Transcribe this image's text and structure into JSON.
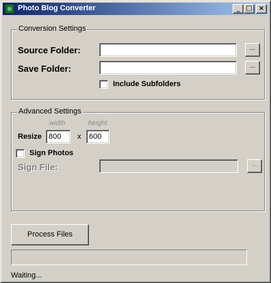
{
  "window": {
    "title": "Photo Blog Converter"
  },
  "title_buttons": {
    "minimize": "_",
    "maximize": "□",
    "close": "×"
  },
  "conversion": {
    "legend": "Conversion Settings",
    "source_label": "Source Folder:",
    "source_value": "",
    "source_browse": "...",
    "save_label": "Save Folder:",
    "save_value": "",
    "save_browse": "...",
    "include_subfolders_label": "Include Subfolders",
    "include_subfolders_checked": false
  },
  "advanced": {
    "legend": "Advanced Settings",
    "width_hint": "width",
    "height_hint": "height",
    "resize_label": "Resize",
    "width_value": "800",
    "separator": "x",
    "height_value": "600",
    "sign_photos_label": "Sign Photos",
    "sign_photos_checked": false,
    "sign_file_label": "Sign File:",
    "sign_file_value": "",
    "sign_file_browse": "..."
  },
  "actions": {
    "process_label": "Process Files"
  },
  "progress": {
    "fraction": 0
  },
  "status": {
    "text": "Waiting..."
  },
  "colors": {
    "titlebar_start": "#0a246a",
    "titlebar_end": "#a6caf0",
    "face": "#d4d0c8"
  }
}
